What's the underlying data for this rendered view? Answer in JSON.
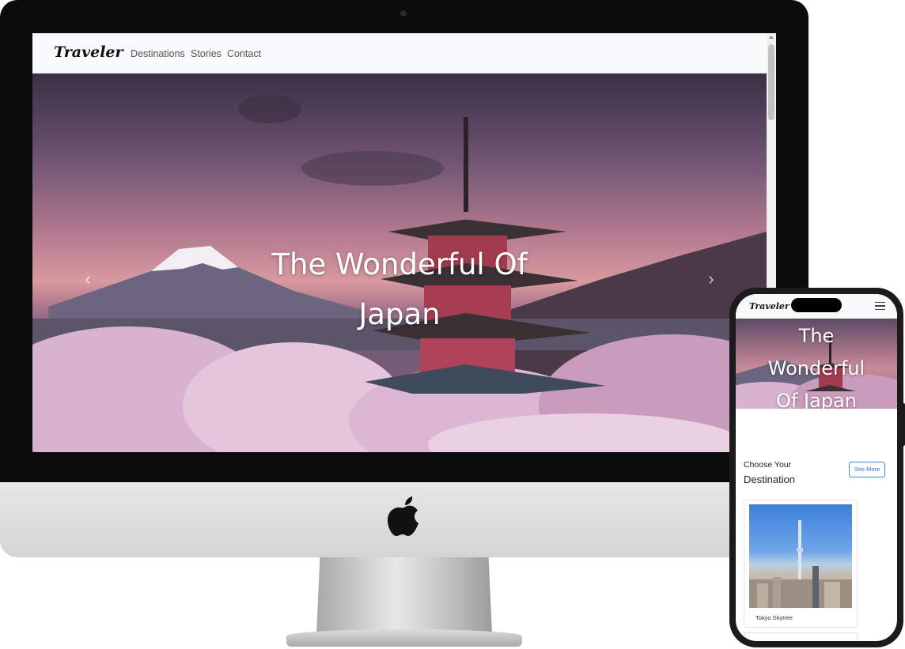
{
  "desktop": {
    "brand": "Traveler",
    "nav_links": [
      "Destinations",
      "Stories",
      "Contact"
    ],
    "hero_title_line1": "The Wonderful Of",
    "hero_title_line2": "Japan"
  },
  "mobile": {
    "brand": "Traveler",
    "hero_title_lines": [
      "The",
      "Wonderful",
      "Of Japan"
    ],
    "section_kicker": "Choose Your",
    "section_title": "Destination",
    "see_more_label": "See More",
    "cards": [
      {
        "caption": "Tokyo Skytree"
      }
    ]
  },
  "icons": {
    "carousel_prev": "chevron-left-icon",
    "carousel_next": "chevron-right-icon",
    "menu": "hamburger-menu-icon",
    "brand_logo": "apple-logo-icon"
  },
  "colors": {
    "accent": "#2f6ad8",
    "navbar_bg": "#f8f9fa"
  }
}
